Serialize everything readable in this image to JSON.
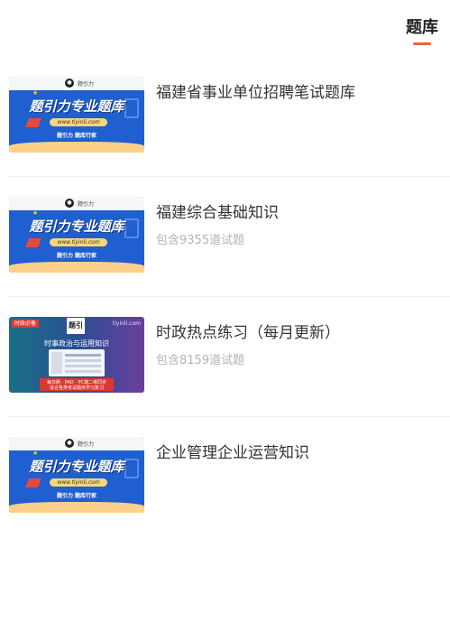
{
  "header": {
    "tab_label": "题库"
  },
  "thumb_banner": {
    "brand": "题引力",
    "title": "题引力专业题库",
    "url": "www.tiyinli.com",
    "footer": "题引力 题库行家"
  },
  "thumb_news": {
    "tag": "时政必备",
    "logo": "题引",
    "site": "tiyinli.com",
    "headline": "时事政治与运用知识",
    "line1": "每日刷 · PAD · PC端二维同步",
    "line2": "适合各类考试题库学习复习"
  },
  "items": [
    {
      "title": "福建省事业单位招聘笔试题库",
      "count": ""
    },
    {
      "title": "福建综合基础知识",
      "count": "包含9355道试题"
    },
    {
      "title": "时政热点练习（每月更新）",
      "count": "包含8159道试题"
    },
    {
      "title": "企业管理企业运营知识",
      "count": ""
    }
  ]
}
